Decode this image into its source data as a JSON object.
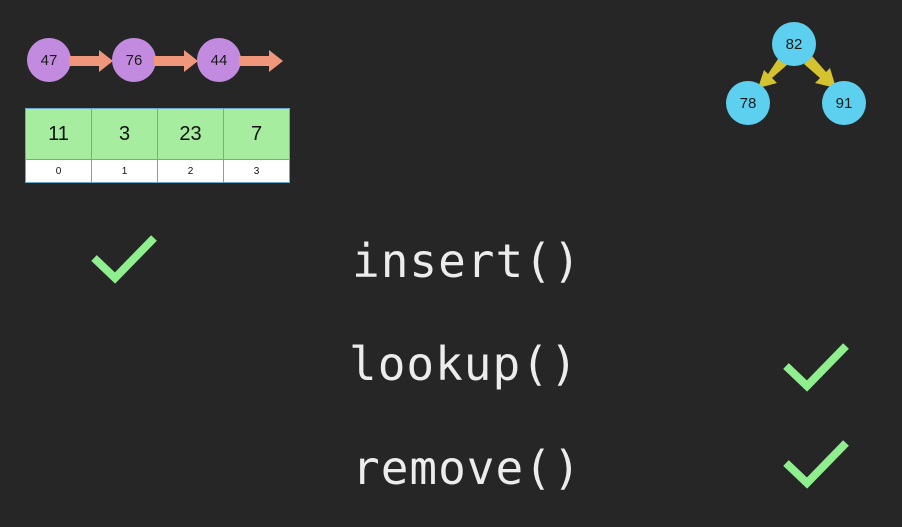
{
  "linked_list": {
    "nodes": [
      "47",
      "76",
      "44"
    ],
    "node_color": "#c38be0",
    "arrow_color": "#f0967a"
  },
  "array": {
    "values": [
      "11",
      "3",
      "23",
      "7"
    ],
    "indices": [
      "0",
      "1",
      "2",
      "3"
    ],
    "cell_color": "#a6eda0"
  },
  "tree": {
    "root": "82",
    "left": "78",
    "right": "91",
    "node_color": "#5dd0ef",
    "arrow_color": "#d4c22e"
  },
  "operations": {
    "insert": "insert()",
    "lookup": "lookup()",
    "remove": "remove()"
  },
  "check_color": "#8fef8f",
  "icons": [
    "check-icon"
  ]
}
